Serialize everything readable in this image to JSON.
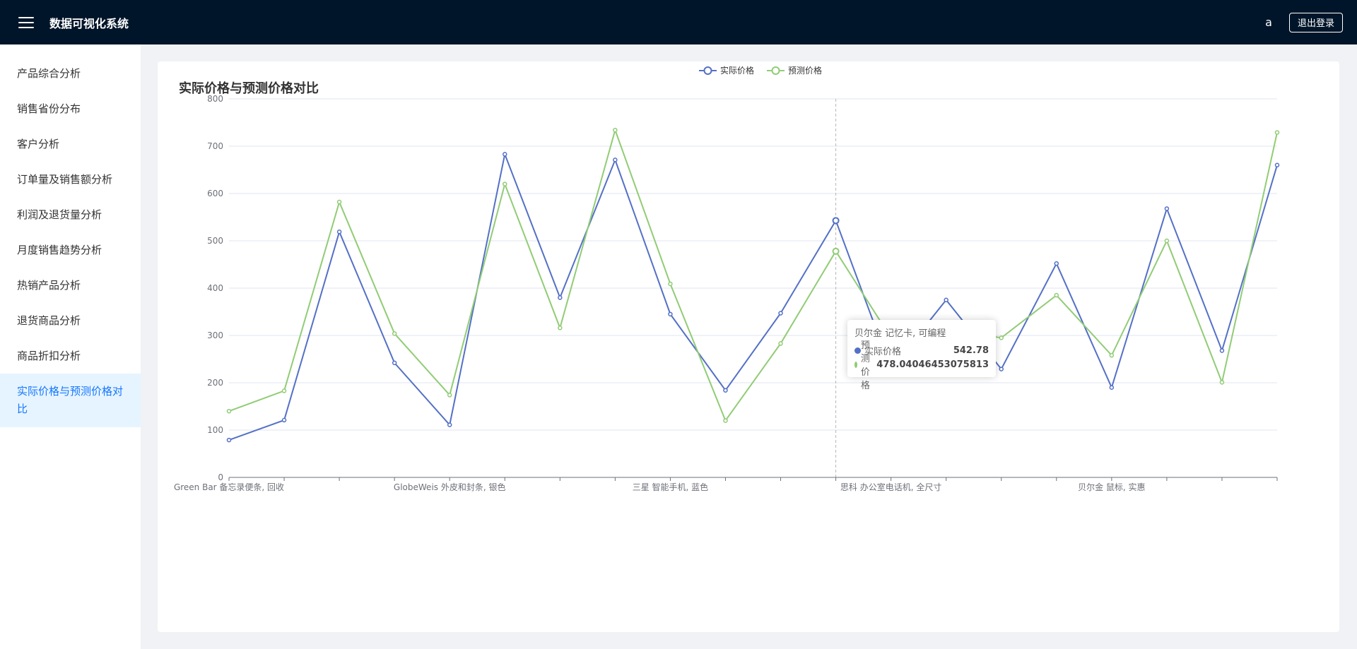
{
  "header": {
    "title": "数据可视化系统",
    "username": "a",
    "logout_label": "退出登录"
  },
  "sidebar": {
    "items": [
      {
        "label": "产品综合分析",
        "active": false
      },
      {
        "label": "销售省份分布",
        "active": false
      },
      {
        "label": "客户分析",
        "active": false
      },
      {
        "label": "订单量及销售额分析",
        "active": false
      },
      {
        "label": "利润及退货量分析",
        "active": false
      },
      {
        "label": "月度销售趋势分析",
        "active": false
      },
      {
        "label": "热销产品分析",
        "active": false
      },
      {
        "label": "退货商品分析",
        "active": false
      },
      {
        "label": "商品折扣分析",
        "active": false
      },
      {
        "label": "实际价格与预测价格对比",
        "active": true
      }
    ]
  },
  "colors": {
    "actual": "#5470c6",
    "predicted": "#91cc75",
    "header_bg": "#001529",
    "active": "#1677ff"
  },
  "tooltip": {
    "title": "贝尔金 记忆卡, 可编程",
    "rows": [
      {
        "name": "实际价格",
        "value": "542.78"
      },
      {
        "name": "预测价格",
        "value": "478.04046453075813"
      }
    ]
  },
  "chart_data": {
    "type": "line",
    "title": "实际价格与预测价格对比",
    "ylim": [
      0,
      800
    ],
    "yticks": [
      0,
      100,
      200,
      300,
      400,
      500,
      600,
      700,
      800
    ],
    "x_tick_labels": [
      {
        "index": 0,
        "label": "Green Bar 备忘录便条, 回收"
      },
      {
        "index": 4,
        "label": "GlobeWeis 外皮和封条, 银色"
      },
      {
        "index": 8,
        "label": "三星 智能手机, 蓝色"
      },
      {
        "index": 12,
        "label": "思科 办公室电话机, 全尺寸"
      },
      {
        "index": 16,
        "label": "贝尔金 鼠标, 实惠"
      }
    ],
    "point_count": 20,
    "highlight_index": 11,
    "grid": true,
    "legend_position": "top-center",
    "series": [
      {
        "name": "实际价格",
        "values": [
          79,
          121,
          519,
          242,
          111,
          683,
          380,
          671,
          345,
          184,
          347,
          542.78,
          229,
          375,
          229,
          452,
          190,
          568,
          268,
          660
        ]
      },
      {
        "name": "预测价格",
        "values": [
          140,
          183,
          582,
          304,
          174,
          620,
          316,
          734,
          409,
          120,
          283,
          478.04,
          295,
          313,
          295,
          385,
          258,
          500,
          201,
          729
        ]
      }
    ]
  }
}
